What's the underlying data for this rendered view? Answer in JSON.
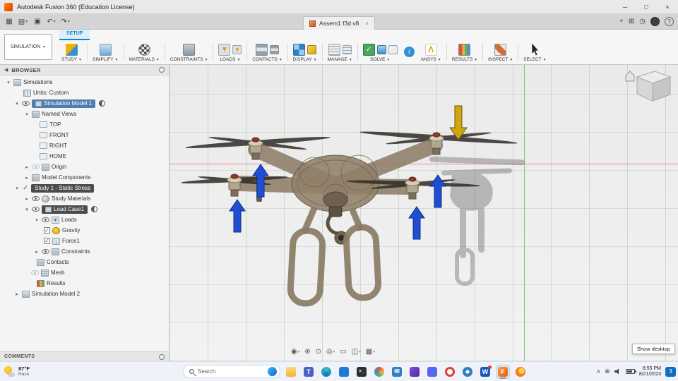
{
  "window": {
    "title": "Autodesk Fusion 360 (Education License)"
  },
  "document": {
    "tab_label": "Assem1 f3d v8"
  },
  "ribbon": {
    "workspace": "SIMULATION",
    "tab_setup": "SETUP",
    "groups": [
      "STUDY",
      "SIMPLIFY",
      "MATERIALS",
      "CONSTRAINTS",
      "LOADS",
      "CONTACTS",
      "DISPLAY",
      "MANAGE",
      "SOLVE",
      "ANSYS",
      "RESULTS",
      "INSPECT",
      "SELECT"
    ]
  },
  "browser": {
    "header": "BROWSER",
    "comments": "COMMENTS",
    "items": {
      "simulations": "Simulations",
      "units": "Units: Custom",
      "sim_model_1": "Simulation Model 1",
      "named_views": "Named Views",
      "view_top": "TOP",
      "view_front": "FRONT",
      "view_right": "RIGHT",
      "view_home": "HOME",
      "origin": "Origin",
      "model_components": "Model Components",
      "study1": "Study 1 - Static Stress",
      "study_materials": "Study Materials",
      "load_case1": "Load Case1",
      "loads": "Loads",
      "gravity": "Gravity",
      "force1": "Force1",
      "constraints": "Constraints",
      "contacts": "Contacts",
      "mesh": "Mesh",
      "results": "Results",
      "sim_model_2": "Simulation Model 2"
    }
  },
  "viewport": {
    "tooltip_show_desktop": "Show desktop",
    "load_arrow_colors": {
      "force": "#1f4fd0",
      "gravity": "#cfa612"
    }
  },
  "taskbar": {
    "weather_temp": "87°F",
    "weather_condition": "Haze",
    "search_placeholder": "Search",
    "apps": [
      "file-explorer",
      "teams",
      "edge",
      "store",
      "terminal",
      "photos",
      "mail",
      "media-player",
      "discord",
      "opera",
      "chrome",
      "word",
      "fusion-360",
      "firefox"
    ],
    "time": "8:55 PM",
    "date": "8/21/2023",
    "notification_count": "3"
  }
}
